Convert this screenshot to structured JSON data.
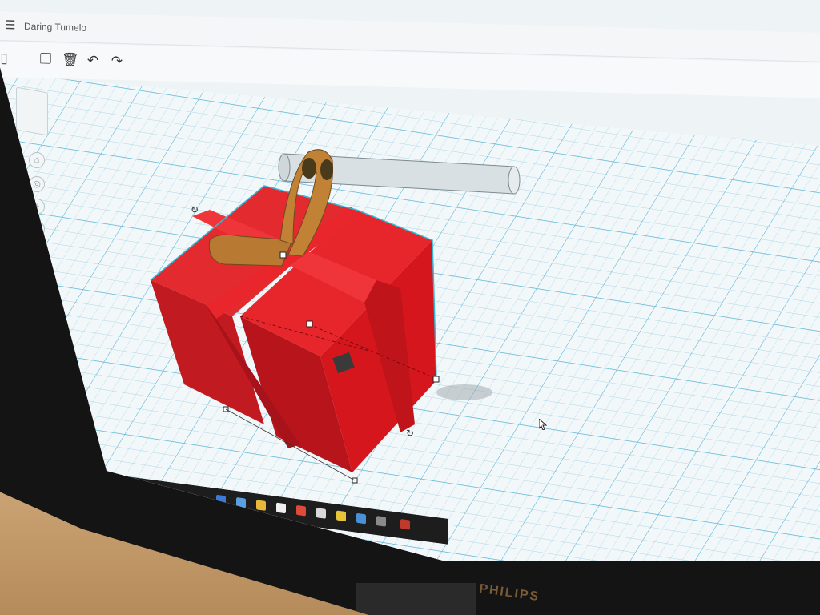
{
  "window": {
    "design_title": "Daring Tumelo"
  },
  "toolbar": {
    "buttons": [
      "copy",
      "delete",
      "undo",
      "redo"
    ]
  },
  "workplane": {
    "grid_color": "#59b5d6",
    "shape_colors": {
      "box": "#e0222a",
      "strap": "#b77b34",
      "rod": "#dfe6e8"
    }
  },
  "monitor": {
    "brand": "PHILIPS"
  }
}
